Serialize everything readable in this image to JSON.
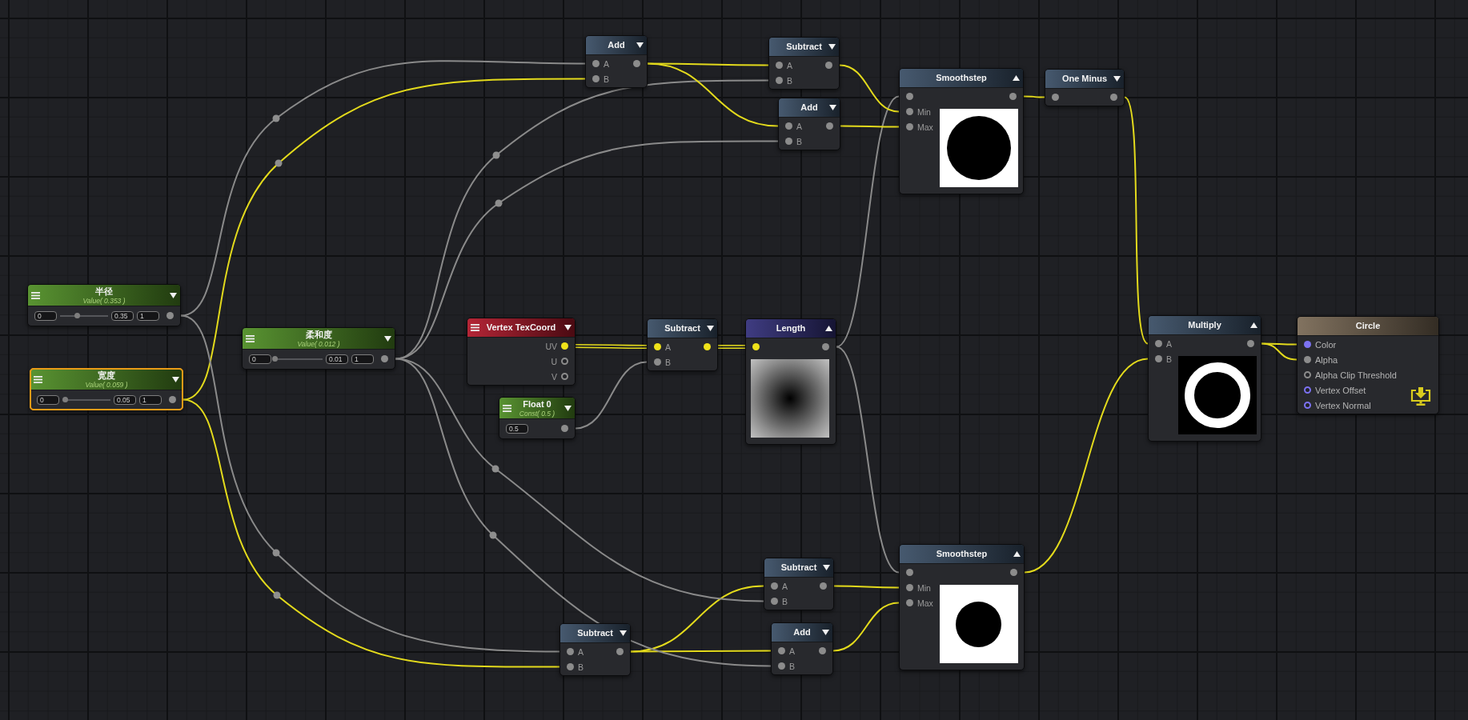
{
  "nodes": [
    {
      "kind": "operator",
      "title": "Add",
      "color": "#3b4f66",
      "selected": false,
      "expanded": false,
      "inputs": [
        {
          "label": "A",
          "color": "#8c8c8c",
          "connected": true,
          "wire": {
            "kind": "single",
            "color": "#8a8a8a"
          }
        },
        {
          "label": "B",
          "color": "#8c8c8c",
          "connected": true,
          "wire": {
            "kind": "single",
            "color": "#e3da1c"
          }
        }
      ],
      "outputs": [
        {
          "color": "#8c8c8c",
          "connected": true
        }
      ]
    },
    {
      "kind": "operator",
      "title": "Subtract",
      "color": "#3b4f66",
      "selected": false,
      "expanded": false,
      "inputs": [
        {
          "label": "A",
          "color": "#8c8c8c",
          "connected": true,
          "wire": {
            "kind": "single",
            "color": "#e3da1c"
          }
        },
        {
          "label": "B",
          "color": "#8c8c8c",
          "connected": true,
          "wire": {
            "kind": "single",
            "color": "#8a8a8a"
          }
        }
      ],
      "outputs": [
        {
          "color": "#8c8c8c",
          "connected": true
        }
      ]
    },
    {
      "kind": "operator",
      "title": "Smoothstep",
      "color": "#3b4f66",
      "selected": false,
      "expanded": true,
      "inputs": [
        {
          "color": "#8c8c8c",
          "connected": true,
          "wire": {
            "kind": "single",
            "color": "#8a8a8a"
          }
        },
        {
          "label": "Min",
          "color": "#8c8c8c",
          "connected": true,
          "wire": {
            "kind": "single",
            "color": "#e3da1c"
          }
        },
        {
          "label": "Max",
          "color": "#8c8c8c",
          "connected": true,
          "wire": {
            "kind": "single",
            "color": "#e3da1c"
          }
        }
      ],
      "outputs": [
        {
          "color": "#8c8c8c",
          "connected": true
        }
      ]
    },
    {
      "kind": "operator",
      "title": "One Minus",
      "color": "#3b4f66",
      "selected": false,
      "expanded": false,
      "inputs": [
        {
          "color": "#8c8c8c",
          "connected": true,
          "wire": {
            "kind": "single",
            "color": "#e3da1c"
          }
        }
      ],
      "outputs": [
        {
          "color": "#8c8c8c",
          "connected": true
        }
      ]
    },
    {
      "kind": "operator",
      "title": "Add",
      "color": "#3b4f66",
      "selected": false,
      "expanded": false,
      "inputs": [
        {
          "label": "A",
          "color": "#8c8c8c",
          "connected": true,
          "wire": {
            "kind": "single",
            "color": "#e3da1c"
          }
        },
        {
          "label": "B",
          "color": "#8c8c8c",
          "connected": true,
          "wire": {
            "kind": "single",
            "color": "#8a8a8a"
          }
        }
      ],
      "outputs": [
        {
          "color": "#8c8c8c",
          "connected": true
        }
      ]
    },
    {
      "kind": "property",
      "title": "半径",
      "subtitle": "Value( 0.353 )",
      "color": "#4f8d25",
      "selected": false,
      "expanded": false,
      "min": "0",
      "value": "0.35",
      "max": "1",
      "level": 0.353,
      "outputs": [
        {
          "color": "#8c8c8c",
          "connected": true
        }
      ]
    },
    {
      "kind": "property",
      "title": "柔和度",
      "subtitle": "Value( 0.012 )",
      "color": "#4f8d25",
      "selected": false,
      "expanded": false,
      "min": "0",
      "value": "0.01",
      "max": "1",
      "level": 0.012,
      "outputs": [
        {
          "color": "#8c8c8c",
          "connected": true
        }
      ]
    },
    {
      "kind": "attribute",
      "title": "Vertex TexCoord",
      "color": "#b0182a",
      "selected": false,
      "expanded": false,
      "outputs": [
        {
          "label": "UV",
          "color": "#efe21a",
          "connected": true
        },
        {
          "label": "U",
          "color": "#8c8c8c",
          "connected": false
        },
        {
          "label": "V",
          "color": "#8c8c8c",
          "connected": false
        }
      ]
    },
    {
      "kind": "operator",
      "title": "Subtract",
      "color": "#3b4f66",
      "selected": false,
      "expanded": false,
      "inputs": [
        {
          "label": "A",
          "color": "#efe21a",
          "connected": true,
          "wire": {
            "kind": "double",
            "color": "#e3da1c"
          }
        },
        {
          "label": "B",
          "color": "#8c8c8c",
          "connected": true,
          "wire": {
            "kind": "single",
            "color": "#8a8a8a"
          }
        }
      ],
      "outputs": [
        {
          "color": "#efe21a",
          "connected": true
        }
      ]
    },
    {
      "kind": "operator",
      "title": "Length",
      "color": "#33307a",
      "selected": false,
      "expanded": true,
      "inputs": [
        {
          "color": "#efe21a",
          "connected": true,
          "wire": {
            "kind": "double",
            "color": "#e3da1c"
          }
        }
      ],
      "outputs": [
        {
          "color": "#8c8c8c",
          "connected": true
        }
      ]
    },
    {
      "kind": "operator",
      "title": "Multiply",
      "color": "#3b4f66",
      "selected": false,
      "expanded": true,
      "inputs": [
        {
          "label": "A",
          "color": "#8c8c8c",
          "connected": true,
          "wire": {
            "kind": "single",
            "color": "#e3da1c"
          }
        },
        {
          "label": "B",
          "color": "#8c8c8c",
          "connected": true,
          "wire": {
            "kind": "single",
            "color": "#e3da1c"
          }
        }
      ],
      "outputs": [
        {
          "color": "#8c8c8c",
          "connected": true
        }
      ]
    },
    {
      "kind": "output",
      "title": "Circle",
      "color": "#7a6a56",
      "selected": false,
      "inputs": [
        {
          "label": "Color",
          "color": "#7c72f2",
          "connected": true,
          "wire": {
            "kind": "single",
            "color": "#e3da1c"
          }
        },
        {
          "label": "Alpha",
          "color": "#8c8c8c",
          "connected": true,
          "wire": {
            "kind": "single",
            "color": "#e3da1c"
          }
        },
        {
          "label": "Alpha Clip Threshold",
          "color": "#8c8c8c",
          "connected": false
        },
        {
          "label": "Vertex Offset",
          "color": "#7c72f2",
          "connected": false
        },
        {
          "label": "Vertex Normal",
          "color": "#7c72f2",
          "connected": false
        }
      ]
    },
    {
      "kind": "property",
      "title": "宽度",
      "subtitle": "Value( 0.059 )",
      "color": "#4f8d25",
      "selected": true,
      "expanded": false,
      "min": "0",
      "value": "0.05",
      "max": "1",
      "level": 0.059,
      "outputs": [
        {
          "color": "#8c8c8c",
          "connected": true
        }
      ]
    },
    {
      "kind": "constant",
      "title": "Float 0",
      "subtitle": "Const( 0.5 )",
      "color": "#4f8d25",
      "selected": false,
      "expanded": false,
      "value": "0.5",
      "outputs": [
        {
          "color": "#8c8c8c",
          "connected": true
        }
      ]
    },
    {
      "kind": "operator",
      "title": "Subtract",
      "color": "#3b4f66",
      "selected": false,
      "expanded": false,
      "inputs": [
        {
          "label": "A",
          "color": "#8c8c8c",
          "connected": true,
          "wire": {
            "kind": "single",
            "color": "#e3da1c"
          }
        },
        {
          "label": "B",
          "color": "#8c8c8c",
          "connected": true,
          "wire": {
            "kind": "single",
            "color": "#8a8a8a"
          }
        }
      ],
      "outputs": [
        {
          "color": "#8c8c8c",
          "connected": true
        }
      ]
    },
    {
      "kind": "operator",
      "title": "Smoothstep",
      "color": "#3b4f66",
      "selected": false,
      "expanded": true,
      "inputs": [
        {
          "color": "#8c8c8c",
          "connected": true,
          "wire": {
            "kind": "single",
            "color": "#8a8a8a"
          }
        },
        {
          "label": "Min",
          "color": "#8c8c8c",
          "connected": true,
          "wire": {
            "kind": "single",
            "color": "#e3da1c"
          }
        },
        {
          "label": "Max",
          "color": "#8c8c8c",
          "connected": true,
          "wire": {
            "kind": "single",
            "color": "#e3da1c"
          }
        }
      ],
      "outputs": [
        {
          "color": "#8c8c8c",
          "connected": true
        }
      ]
    },
    {
      "kind": "operator",
      "title": "Subtract",
      "color": "#3b4f66",
      "selected": false,
      "expanded": false,
      "inputs": [
        {
          "label": "A",
          "color": "#8c8c8c",
          "connected": true,
          "wire": {
            "kind": "single",
            "color": "#8a8a8a"
          }
        },
        {
          "label": "B",
          "color": "#8c8c8c",
          "connected": true,
          "wire": {
            "kind": "single",
            "color": "#e3da1c"
          }
        }
      ],
      "outputs": [
        {
          "color": "#8c8c8c",
          "connected": true
        }
      ]
    },
    {
      "kind": "operator",
      "title": "Add",
      "color": "#3b4f66",
      "selected": false,
      "expanded": false,
      "inputs": [
        {
          "label": "A",
          "color": "#8c8c8c",
          "connected": true,
          "wire": {
            "kind": "single",
            "color": "#e3da1c"
          }
        },
        {
          "label": "B",
          "color": "#8c8c8c",
          "connected": true,
          "wire": {
            "kind": "single",
            "color": "#8a8a8a"
          }
        }
      ],
      "outputs": [
        {
          "color": "#8c8c8c",
          "connected": true
        }
      ]
    }
  ]
}
